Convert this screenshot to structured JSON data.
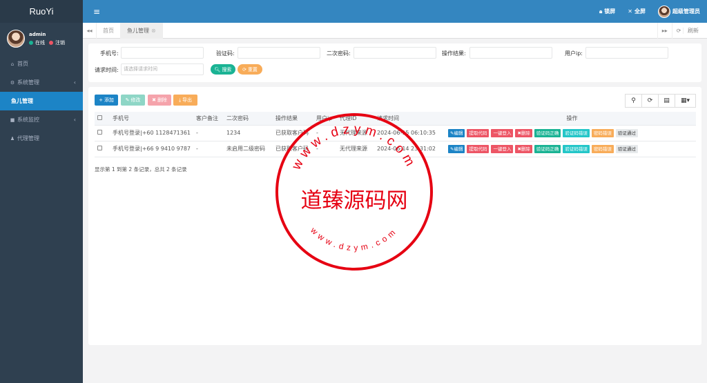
{
  "brand": "RuoYi",
  "user": {
    "name": "admin",
    "status_online": "在线",
    "logout": "注销"
  },
  "sidebar": {
    "items": [
      {
        "label": "首页",
        "icon": "home-icon",
        "glyph": "⌂"
      },
      {
        "label": "系统管理",
        "icon": "gear-icon",
        "glyph": "⚙",
        "chevron": "‹"
      },
      {
        "label": "鱼儿管理",
        "icon": "",
        "glyph": "",
        "active": true
      },
      {
        "label": "系统监控",
        "icon": "video-icon",
        "glyph": "■",
        "chevron": "‹"
      },
      {
        "label": "代理管理",
        "icon": "user-icon",
        "glyph": "♟"
      }
    ]
  },
  "topbar": {
    "lock": "锁屏",
    "fullscreen": "全屏",
    "admin": "超级管理员"
  },
  "tabs": {
    "home": "首页",
    "current": "鱼儿管理",
    "refresh": "刷新"
  },
  "search": {
    "phone_label": "手机号:",
    "code_label": "验证码:",
    "pwd2_label": "二次密码:",
    "result_label": "操作结果:",
    "ip_label": "用户ip:",
    "time_label": "请求时间:",
    "time_placeholder": "请选择请求时间",
    "search_btn": "搜索",
    "reset_btn": "重置"
  },
  "toolbar": {
    "add": "添加",
    "edit": "修改",
    "delete": "删除",
    "export": "导出"
  },
  "table": {
    "headers": [
      "手机号",
      "客户备注",
      "二次密码",
      "操作结果",
      "用户ip",
      "代理ID",
      "请求时间",
      "操作"
    ],
    "rows": [
      {
        "phone": "手机号登录|+60 1128471361",
        "remark": "-",
        "pwd2": "1234",
        "result": "已获取客户码",
        "ip": "-",
        "agent": "无代理来源",
        "time": "2024-06-15 06:10:35"
      },
      {
        "phone": "手机号登录|+66 9 9410 9787",
        "remark": "-",
        "pwd2": "未启用二级密码",
        "result": "已获取客户码",
        "ip": "-",
        "agent": "无代理来源",
        "time": "2024-06-14 23:31:02"
      }
    ],
    "ops": [
      {
        "label": "编辑",
        "color": "#1c84c6"
      },
      {
        "label": "提取代码",
        "color": "#ed5565"
      },
      {
        "label": "一键登入",
        "color": "#ed5565"
      },
      {
        "label": "删除",
        "color": "#ed5565"
      },
      {
        "label": "验证码正确",
        "color": "#1ab394"
      },
      {
        "label": "验证码错误",
        "color": "#23c6c8"
      },
      {
        "label": "密码错误",
        "color": "#f8ac59"
      },
      {
        "label": "验证通过",
        "color": "#e7eaec"
      }
    ]
  },
  "pager": "显示第 1 到第 2 条记录，总共 2 条记录",
  "watermark": {
    "center": "道臻源码网",
    "ring": "www.dzym.com"
  }
}
